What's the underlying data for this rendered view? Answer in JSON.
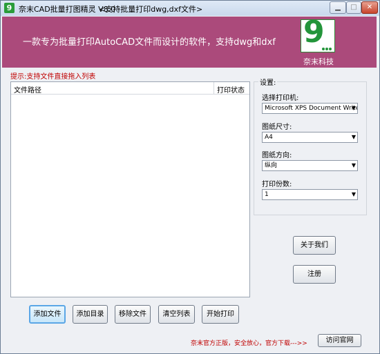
{
  "window": {
    "title": "奈末CAD批量打图精灵 V8.0",
    "subtitle": "<支持批量打印dwg,dxf文件>",
    "controls": {
      "minimize": "▁",
      "maximize": "□",
      "close": "✕"
    }
  },
  "banner": {
    "slogan": "一款专为批量打印AutoCAD文件而设计的软件，支持dwg和dxf",
    "logo_text": "9",
    "company": "奈末科技",
    "color": "#ab4a7b"
  },
  "hint": "提示:支持文件直接拖入列表",
  "file_list": {
    "columns": [
      "文件路径",
      "打印状态"
    ],
    "rows": []
  },
  "settings": {
    "legend": "设置:",
    "printer_label": "选择打印机:",
    "printer_value": "Microsoft XPS Document Write",
    "paper_label": "图纸尺寸:",
    "paper_value": "A4",
    "orientation_label": "图纸方向:",
    "orientation_value": "纵向",
    "copies_label": "打印份数:",
    "copies_value": "1"
  },
  "side_buttons": {
    "about": "关于我们",
    "register": "注册"
  },
  "toolbar": {
    "add_file": "添加文件",
    "add_dir": "添加目录",
    "remove_file": "移除文件",
    "clear_list": "清空列表",
    "start_print": "开始打印"
  },
  "footer": {
    "promo": "奈末官方正版，安全放心，官方下载--->>",
    "visit_site": "访问官网"
  }
}
